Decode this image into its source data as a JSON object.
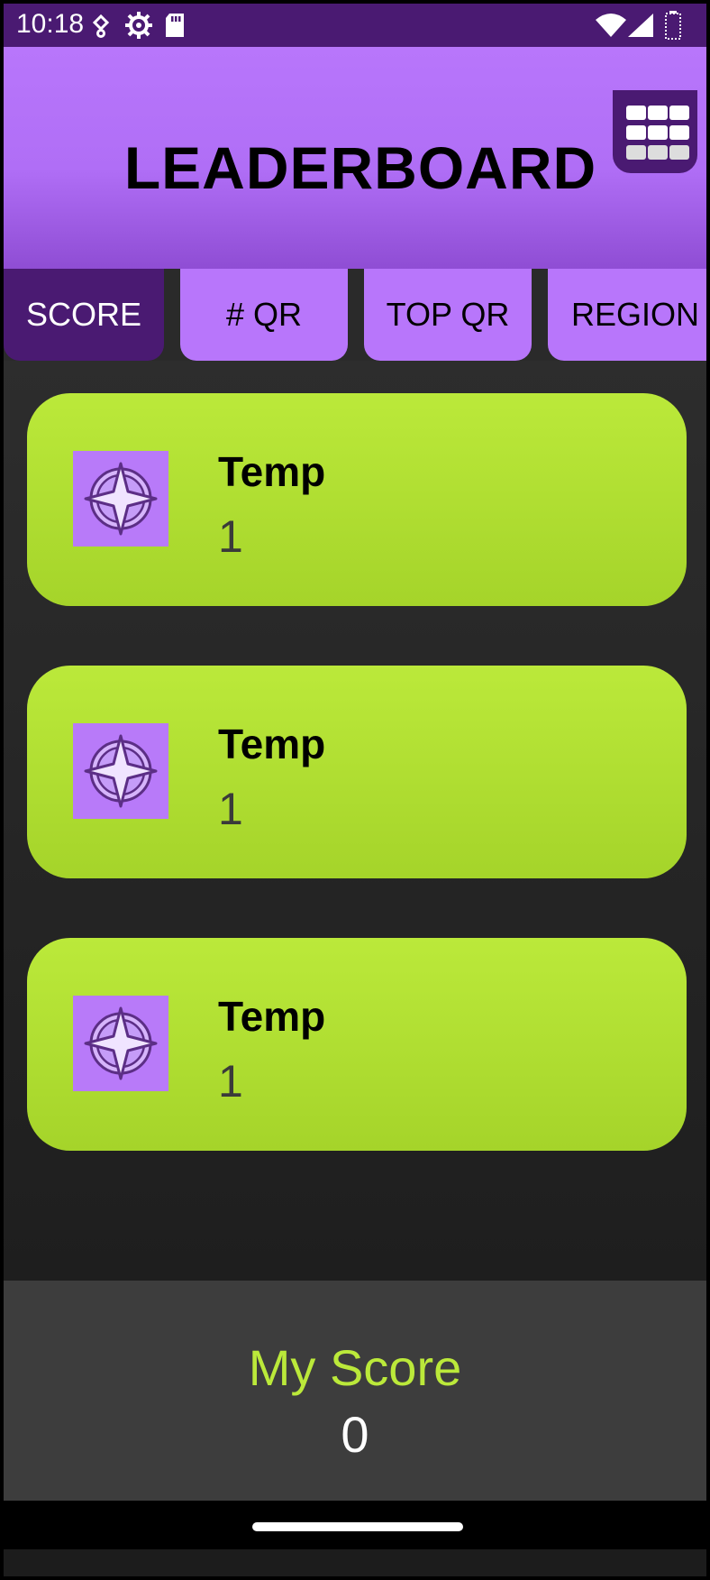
{
  "status_bar": {
    "time": "10:18",
    "icons": [
      "location-icon",
      "settings-gear-icon",
      "sd-card-icon",
      "wifi-icon",
      "signal-icon",
      "battery-icon"
    ]
  },
  "header": {
    "title": "LEADERBOARD",
    "menu_icon": "grid-menu-icon"
  },
  "tabs": [
    {
      "label": "SCORE",
      "active": true
    },
    {
      "label": "# QR",
      "active": false
    },
    {
      "label": "TOP QR",
      "active": false
    },
    {
      "label": "REGION",
      "active": false
    }
  ],
  "entries": [
    {
      "name": "Temp",
      "score": "1",
      "avatar_icon": "compass-star-icon"
    },
    {
      "name": "Temp",
      "score": "1",
      "avatar_icon": "compass-star-icon"
    },
    {
      "name": "Temp",
      "score": "1",
      "avatar_icon": "compass-star-icon"
    }
  ],
  "my_score": {
    "label": "My Score",
    "value": "0"
  },
  "colors": {
    "header_purple": "#b876fb",
    "dark_purple": "#4a1a72",
    "card_green": "#bbe93a",
    "background": "#2a2a2a",
    "my_score_panel": "#3d3d3d"
  }
}
